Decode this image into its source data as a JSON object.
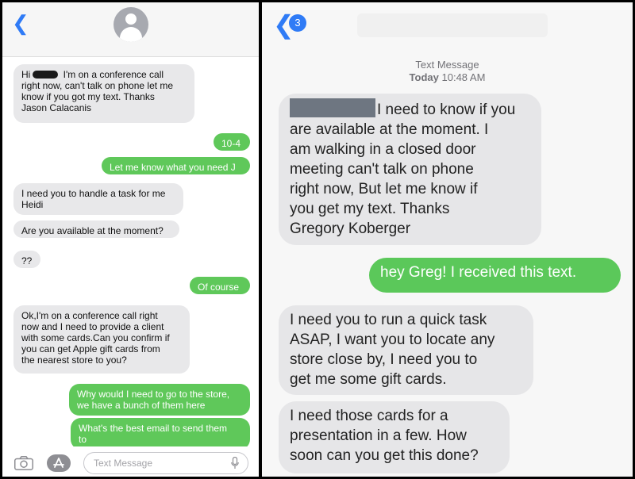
{
  "left": {
    "messages": [
      {
        "dir": "in",
        "pre": "Hi",
        "redacted": true,
        "text": " I'm on a conference call\nright now, can't talk on phone let me\nknow if you got my text. Thanks\nJason Calacanis"
      },
      {
        "dir": "out",
        "text": "10-4"
      },
      {
        "dir": "out",
        "text": "Let me know what you need J"
      },
      {
        "dir": "in",
        "text": "I need you to handle a task for me\nHeidi"
      },
      {
        "dir": "in",
        "text": "Are you available at the moment?"
      },
      {
        "dir": "in",
        "text": "??"
      },
      {
        "dir": "out",
        "text": "Of course"
      },
      {
        "dir": "in",
        "text": "Ok,I'm on a conference call right\nnow and I need to provide a client\nwith some cards.Can you confirm if\nyou can get Apple gift cards from\nthe nearest store to you?"
      },
      {
        "dir": "out",
        "text": "Why would I need to go to the store,\nwe have a bunch of them here"
      },
      {
        "dir": "out",
        "text": "What's the best email to send them\nto"
      }
    ],
    "composer": {
      "placeholder": "Text Message"
    }
  },
  "right": {
    "badge_count": "3",
    "timestamp": {
      "label": "Text Message",
      "day": "Today",
      "time": "10:48 AM"
    },
    "messages": [
      {
        "dir": "in",
        "redacted": true,
        "text": "I need to know if you\nare available at the moment. I\nam walking in a closed door\nmeeting can't talk on phone\nright now, But let me know if\nyou get my text. Thanks\nGregory Koberger"
      },
      {
        "dir": "out",
        "text": "hey Greg! I received this text."
      },
      {
        "dir": "in",
        "text": "I need you to run a quick task\nASAP, I want you to locate any\nstore close by, I need you to\nget me some gift cards."
      },
      {
        "dir": "in",
        "text": "I need those cards for a\npresentation in a few. How\nsoon can you get this done?"
      }
    ]
  },
  "colors": {
    "ios_blue": "#2f7bf6",
    "sms_green": "#5fc85a",
    "incoming_gray": "#e8e8ea"
  },
  "icons": [
    "back-chevron-icon",
    "contact-avatar-icon",
    "camera-icon",
    "app-store-icon",
    "microphone-icon"
  ]
}
